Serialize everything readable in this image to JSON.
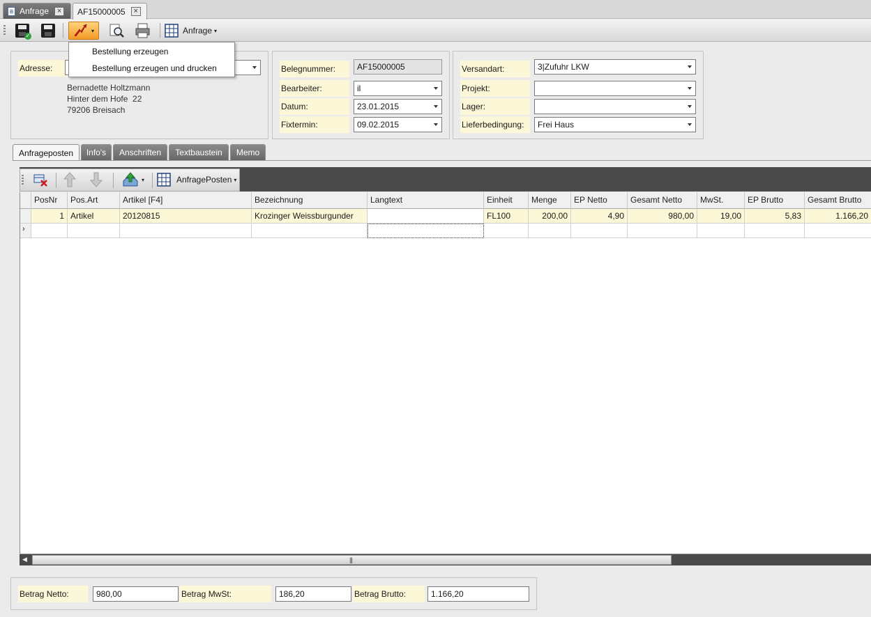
{
  "doc_tabs": [
    {
      "label": "Anfrage"
    },
    {
      "label": "AF15000005"
    }
  ],
  "toolbar": {
    "anfrage_menu_label": "Anfrage"
  },
  "menu": {
    "items": [
      "Bestellung erzeugen",
      "Bestellung erzeugen und drucken"
    ]
  },
  "address": {
    "label": "Adresse:",
    "value": "",
    "lines": [
      "Bernadette Holtzmann",
      "Hinter dem Hofe  22",
      "79206 Breisach"
    ]
  },
  "doc_info": {
    "belegnummer_label": "Belegnummer:",
    "belegnummer": "AF15000005",
    "bearbeiter_label": "Bearbeiter:",
    "bearbeiter": "il",
    "datum_label": "Datum:",
    "datum": "23.01.2015",
    "fixtermin_label": "Fixtermin:",
    "fixtermin": "09.02.2015"
  },
  "shipping": {
    "versandart_label": "Versandart:",
    "versandart": "3|Zufuhr LKW",
    "projekt_label": "Projekt:",
    "projekt": "",
    "lager_label": "Lager:",
    "lager": "",
    "lieferbedingung_label": "Lieferbedingung:",
    "lieferbedingung": "Frei Haus"
  },
  "content_tabs": [
    "Anfrageposten",
    "Info's",
    "Anschriften",
    "Textbaustein",
    "Memo"
  ],
  "inner_toolbar": {
    "posten_menu_label": "AnfragePosten"
  },
  "grid": {
    "columns": [
      "PosNr",
      "Pos.Art",
      "Artikel [F4]",
      "Bezeichnung",
      "Langtext",
      "Einheit",
      "Menge",
      "EP Netto",
      "Gesamt Netto",
      "MwSt.",
      "EP Brutto",
      "Gesamt Brutto"
    ],
    "rows": [
      [
        "1",
        "Artikel",
        "20120815",
        "Krozinger Weissburgunder",
        "",
        "FL100",
        "200,00",
        "4,90",
        "980,00",
        "19,00",
        "5,83",
        "1.166,20"
      ]
    ]
  },
  "totals": {
    "netto_label": "Betrag Netto:",
    "netto": "980,00",
    "mwst_label": "Betrag MwSt:",
    "mwst": "186,20",
    "brutto_label": "Betrag Brutto:",
    "brutto": "1.166,20"
  }
}
